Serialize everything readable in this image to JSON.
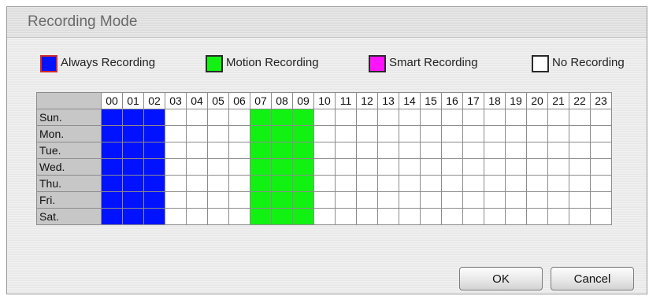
{
  "window": {
    "title": "Recording Mode"
  },
  "legend": [
    {
      "label": "Always Recording",
      "color": "#0012ff",
      "selected": true
    },
    {
      "label": "Motion Recording",
      "color": "#12f212",
      "selected": false
    },
    {
      "label": "Smart Recording",
      "color": "#ff14ff",
      "selected": false
    },
    {
      "label": "No Recording",
      "color": "#ffffff",
      "selected": false
    }
  ],
  "schedule": {
    "hours": [
      "00",
      "01",
      "02",
      "03",
      "04",
      "05",
      "06",
      "07",
      "08",
      "09",
      "10",
      "11",
      "12",
      "13",
      "14",
      "15",
      "16",
      "17",
      "18",
      "19",
      "20",
      "21",
      "22",
      "23"
    ],
    "days": [
      "Sun.",
      "Mon.",
      "Tue.",
      "Wed.",
      "Thu.",
      "Fri.",
      "Sat."
    ],
    "always_hours": [
      0,
      1,
      2
    ],
    "motion_hours": [
      7,
      8,
      9
    ],
    "smart_hours": []
  },
  "buttons": {
    "ok": "OK",
    "cancel": "Cancel"
  }
}
